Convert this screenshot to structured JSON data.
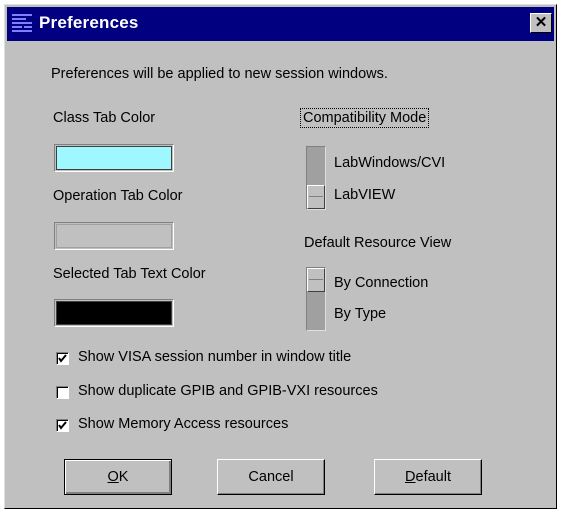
{
  "window": {
    "title": "Preferences",
    "close_label": "✕"
  },
  "intro_text": "Preferences will be applied to new session windows.",
  "colors": {
    "class_tab": {
      "label": "Class Tab Color",
      "value": "#9ff7ff"
    },
    "operation_tab": {
      "label": "Operation Tab Color",
      "value": "#c0c0c0"
    },
    "selected_tab_text": {
      "label": "Selected Tab Text Color",
      "value": "#000000"
    }
  },
  "compatibility": {
    "label": "Compatibility Mode",
    "options": [
      "LabWindows/CVI",
      "LabVIEW"
    ],
    "selected": "LabVIEW"
  },
  "resource_view": {
    "label": "Default Resource View",
    "options": [
      "By Connection",
      "By Type"
    ],
    "selected": "By Connection"
  },
  "checkboxes": [
    {
      "label": "Show VISA session number in window title",
      "checked": true
    },
    {
      "label": "Show duplicate GPIB and GPIB-VXI resources",
      "checked": false
    },
    {
      "label": "Show Memory Access resources",
      "checked": true
    }
  ],
  "buttons": {
    "ok": {
      "mnemonic": "O",
      "rest": "K"
    },
    "cancel": "Cancel",
    "default": {
      "mnemonic": "D",
      "rest": "efault"
    }
  }
}
